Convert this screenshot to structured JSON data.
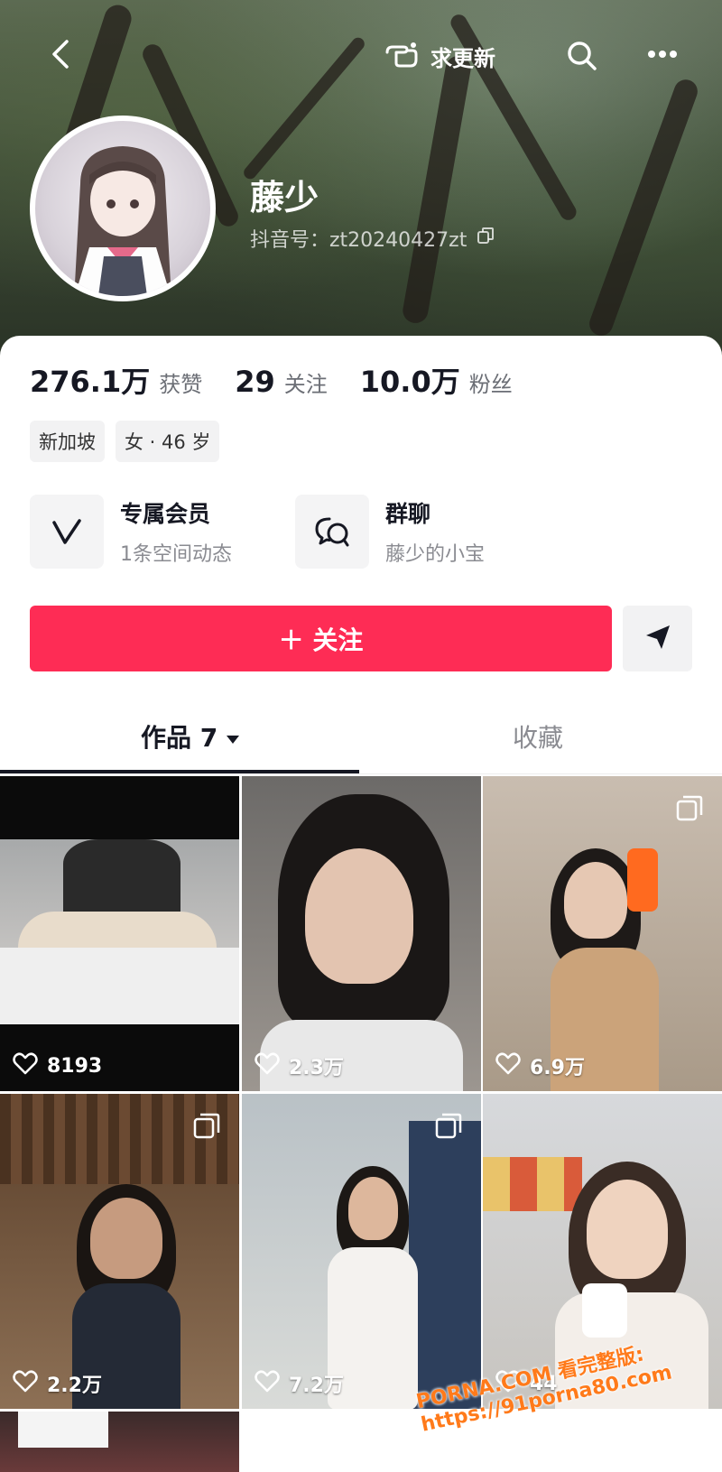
{
  "topbar": {
    "request_update_label": "求更新"
  },
  "profile": {
    "name": "藤少",
    "douyin_id": "抖音号：zt20240427zt"
  },
  "stats": [
    {
      "value": "276.1万",
      "label": "获赞"
    },
    {
      "value": "29",
      "label": "关注"
    },
    {
      "value": "10.0万",
      "label": "粉丝"
    }
  ],
  "tags": [
    "新加坡",
    "女 · 46 岁"
  ],
  "features": [
    {
      "title": "专属会员",
      "subtitle": "1条空间动态"
    },
    {
      "title": "群聊",
      "subtitle": "藤少的小宝"
    }
  ],
  "actions": {
    "follow_label": "＋ 关注"
  },
  "tabs": {
    "works_label": "作品 7",
    "favorites_label": "收藏"
  },
  "videos": [
    {
      "likes": "8193",
      "multi": false
    },
    {
      "likes": "2.3万",
      "multi": false
    },
    {
      "likes": "6.9万",
      "multi": true
    },
    {
      "likes": "2.2万",
      "multi": true
    },
    {
      "likes": "7.2万",
      "multi": true
    },
    {
      "likes": "44",
      "multi": false
    }
  ],
  "watermark": "PORNA.COM 看完整版: https://91porna80.com",
  "colors": {
    "accent": "#fe2c55",
    "text_primary": "#161823",
    "text_secondary": "#8a8b91"
  }
}
